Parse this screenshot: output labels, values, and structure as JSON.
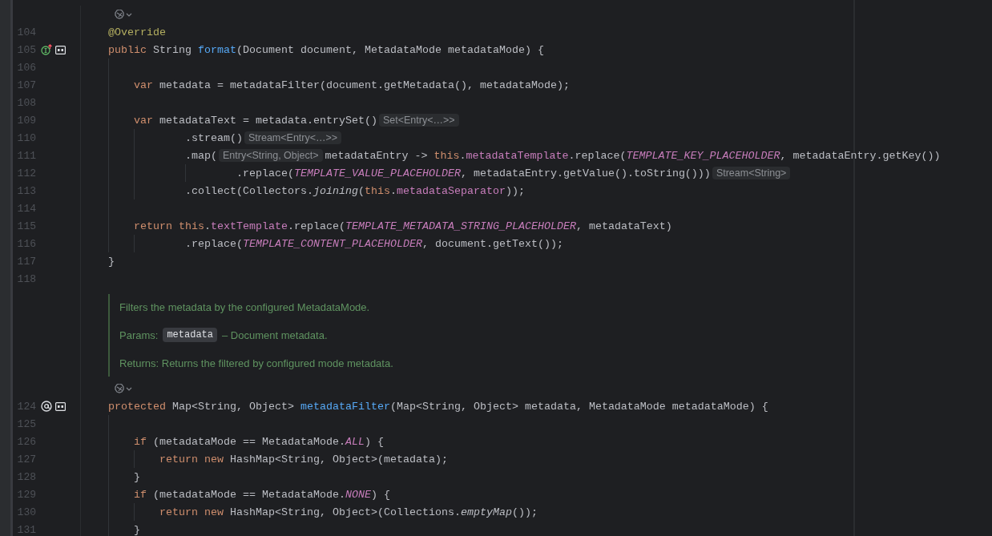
{
  "editor": {
    "rows": [
      {
        "kind": "ai-actions"
      },
      {
        "kind": "code",
        "number": "104",
        "parts": [
          {
            "code": [
              {
                "kind": "ann",
                "text": "@Override"
              }
            ]
          }
        ]
      },
      {
        "kind": "code",
        "number": "105",
        "gutter": [
          {
            "kind": "overrides"
          },
          {
            "kind": "render-doc"
          }
        ],
        "parts": [
          {
            "code": [
              {
                "kind": "kw",
                "text": "public"
              },
              {
                "kind": "p",
                "text": " String "
              },
              {
                "kind": "fn",
                "text": "format"
              },
              {
                "kind": "p",
                "text": "(Document document, MetadataMode metadataMode) {"
              }
            ]
          }
        ],
        "children": [
          {
            "kind": "code",
            "number": "106"
          },
          {
            "kind": "code",
            "number": "107",
            "parts": [
              {
                "code": [
                  {
                    "kind": "kw",
                    "text": "var"
                  },
                  {
                    "kind": "p",
                    "text": " metadata = metadataFilter(document.getMetadata(), metadataMode);"
                  }
                ]
              }
            ]
          },
          {
            "kind": "code",
            "number": "108"
          },
          {
            "kind": "code",
            "number": "109",
            "parts": [
              {
                "code": [
                  {
                    "kind": "kw",
                    "text": "var"
                  },
                  {
                    "kind": "p",
                    "text": " metadataText = metadata.entrySet()"
                  }
                ]
              },
              {
                "hint": "Set<Entry<…>>"
              }
            ],
            "children": [
              {
                "kind": "continuation",
                "number": "110",
                "parts": [
                  {
                    "code": [
                      {
                        "kind": "p",
                        "text": ".stream()"
                      }
                    ]
                  },
                  {
                    "hint": "Stream<Entry<…>>"
                  }
                ]
              },
              {
                "kind": "continuation",
                "number": "111",
                "parts": [
                  {
                    "code": [
                      {
                        "kind": "p",
                        "text": ".map("
                      }
                    ]
                  },
                  {
                    "hint": "Entry<String, Object>"
                  },
                  {
                    "code": [
                      {
                        "kind": "p",
                        "text": "metadataEntry -> "
                      },
                      {
                        "kind": "kw",
                        "text": "this"
                      },
                      {
                        "kind": "p",
                        "text": "."
                      },
                      {
                        "kind": "f",
                        "text": "metadataTemplate"
                      },
                      {
                        "kind": "p",
                        "text": ".replace("
                      },
                      {
                        "kind": "c",
                        "text": "TEMPLATE_KEY_PLACEHOLDER"
                      },
                      {
                        "kind": "p",
                        "text": ", metadataEntry.getKey())"
                      }
                    ]
                  }
                ],
                "children": [
                  {
                    "kind": "continuation",
                    "number": "112",
                    "parts": [
                      {
                        "code": [
                          {
                            "kind": "p",
                            "text": ".replace("
                          },
                          {
                            "kind": "c",
                            "text": "TEMPLATE_VALUE_PLACEHOLDER"
                          },
                          {
                            "kind": "p",
                            "text": ", metadataEntry.getValue().toString()))"
                          }
                        ]
                      },
                      {
                        "hint": "Stream<String>"
                      }
                    ]
                  }
                ]
              },
              {
                "kind": "continuation",
                "number": "113",
                "parts": [
                  {
                    "code": [
                      {
                        "kind": "p",
                        "text": ".collect(Collectors."
                      },
                      {
                        "kind": "i",
                        "text": "joining"
                      },
                      {
                        "kind": "p",
                        "text": "("
                      },
                      {
                        "kind": "kw",
                        "text": "this"
                      },
                      {
                        "kind": "p",
                        "text": "."
                      },
                      {
                        "kind": "f",
                        "text": "metadataSeparator"
                      },
                      {
                        "kind": "p",
                        "text": "));"
                      }
                    ]
                  }
                ]
              }
            ]
          },
          {
            "kind": "code",
            "number": "114"
          },
          {
            "kind": "code",
            "number": "115",
            "parts": [
              {
                "code": [
                  {
                    "kind": "kw",
                    "text": "return this"
                  },
                  {
                    "kind": "p",
                    "text": "."
                  },
                  {
                    "kind": "f",
                    "text": "textTemplate"
                  },
                  {
                    "kind": "p",
                    "text": ".replace("
                  },
                  {
                    "kind": "c",
                    "text": "TEMPLATE_METADATA_STRING_PLACEHOLDER"
                  },
                  {
                    "kind": "p",
                    "text": ", metadataText)"
                  }
                ]
              }
            ],
            "children": [
              {
                "kind": "continuation",
                "number": "116",
                "parts": [
                  {
                    "code": [
                      {
                        "kind": "p",
                        "text": ".replace("
                      },
                      {
                        "kind": "c",
                        "text": "TEMPLATE_CONTENT_PLACEHOLDER"
                      },
                      {
                        "kind": "p",
                        "text": ", document.getText());"
                      }
                    ]
                  }
                ]
              }
            ]
          }
        ]
      },
      {
        "kind": "code",
        "number": "117",
        "parts": [
          {
            "code": [
              {
                "kind": "p",
                "text": "}"
              }
            ]
          }
        ]
      },
      {
        "kind": "code",
        "number": "118"
      },
      {
        "kind": "doc",
        "summary": "Filters the metadata by the configured MetadataMode.",
        "params_label": "Params:",
        "param_name": "metadata",
        "param_text": "– Document metadata.",
        "returns": "Returns: Returns the filtered by configured mode metadata."
      },
      {
        "kind": "ai-actions"
      },
      {
        "kind": "code",
        "number": "124",
        "gutter": [
          {
            "kind": "implemented"
          },
          {
            "kind": "render-doc"
          }
        ],
        "parts": [
          {
            "code": [
              {
                "kind": "kw",
                "text": "protected"
              },
              {
                "kind": "p",
                "text": " Map<String, Object> "
              },
              {
                "kind": "fn",
                "text": "metadataFilter"
              },
              {
                "kind": "p",
                "text": "(Map<String, Object> metadata, MetadataMode metadataMode) {"
              }
            ]
          }
        ],
        "children": [
          {
            "kind": "code",
            "number": "125"
          },
          {
            "kind": "code",
            "number": "126",
            "parts": [
              {
                "code": [
                  {
                    "kind": "kw",
                    "text": "if"
                  },
                  {
                    "kind": "p",
                    "text": " (metadataMode == MetadataMode."
                  },
                  {
                    "kind": "c",
                    "text": "ALL"
                  },
                  {
                    "kind": "p",
                    "text": ") {"
                  }
                ]
              }
            ],
            "children": [
              {
                "kind": "code",
                "number": "127",
                "parts": [
                  {
                    "code": [
                      {
                        "kind": "kw",
                        "text": "return new"
                      },
                      {
                        "kind": "p",
                        "text": " HashMap<String, Object>(metadata);"
                      }
                    ]
                  }
                ]
              }
            ]
          },
          {
            "kind": "code",
            "number": "128",
            "parts": [
              {
                "code": [
                  {
                    "kind": "p",
                    "text": "}"
                  }
                ]
              }
            ]
          },
          {
            "kind": "code",
            "number": "129",
            "parts": [
              {
                "code": [
                  {
                    "kind": "kw",
                    "text": "if"
                  },
                  {
                    "kind": "p",
                    "text": " (metadataMode == MetadataMode."
                  },
                  {
                    "kind": "c",
                    "text": "NONE"
                  },
                  {
                    "kind": "p",
                    "text": ") {"
                  }
                ]
              }
            ],
            "children": [
              {
                "kind": "code",
                "number": "130",
                "parts": [
                  {
                    "code": [
                      {
                        "kind": "kw",
                        "text": "return new"
                      },
                      {
                        "kind": "p",
                        "text": " HashMap<String, Object>(Collections."
                      },
                      {
                        "kind": "i",
                        "text": "emptyMap"
                      },
                      {
                        "kind": "p",
                        "text": "());"
                      }
                    ]
                  }
                ]
              }
            ]
          },
          {
            "kind": "code",
            "number": "131",
            "parts": [
              {
                "code": [
                  {
                    "kind": "p",
                    "text": "}"
                  }
                ]
              }
            ]
          }
        ]
      }
    ]
  }
}
